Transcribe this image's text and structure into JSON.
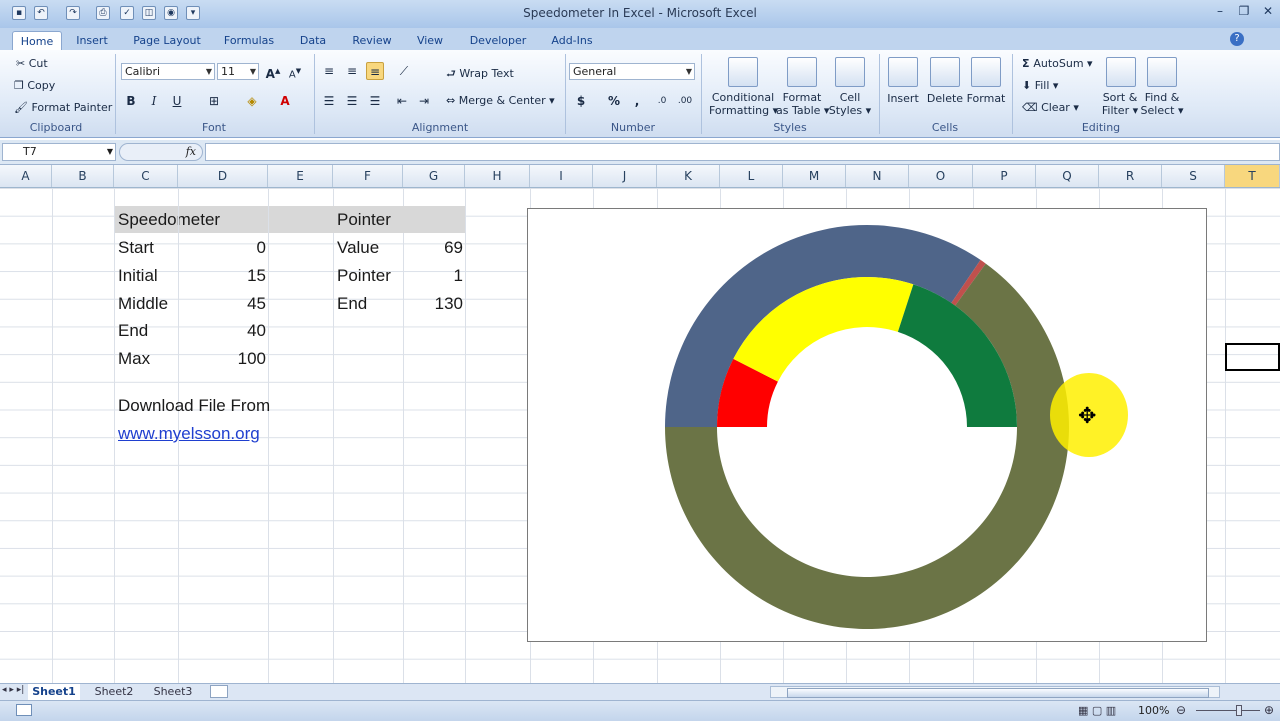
{
  "window": {
    "title": "Speedometer In Excel - Microsoft Excel"
  },
  "tabs": [
    "Home",
    "Insert",
    "Page Layout",
    "Formulas",
    "Data",
    "Review",
    "View",
    "Developer",
    "Add-Ins"
  ],
  "clipboard": {
    "cut": "Cut",
    "copy": "Copy",
    "format_painter": "Format Painter",
    "label": "Clipboard"
  },
  "font": {
    "name": "Calibri",
    "size": "11",
    "label": "Font"
  },
  "alignment": {
    "wrap": "Wrap Text",
    "merge": "Merge & Center",
    "label": "Alignment"
  },
  "number": {
    "format": "General",
    "label": "Number"
  },
  "styles": {
    "conditional": "Conditional",
    "formatting": "Formatting",
    "format_as": "Format",
    "as_table": "as Table",
    "cell": "Cell",
    "cell_styles": "Styles",
    "label": "Styles"
  },
  "cells": {
    "insert": "Insert",
    "delete": "Delete",
    "format": "Format",
    "label": "Cells"
  },
  "editing": {
    "autosum": "AutoSum",
    "fill": "Fill",
    "clear": "Clear",
    "sort": "Sort &",
    "filter": "Filter",
    "find": "Find &",
    "select": "Select",
    "label": "Editing"
  },
  "namebox": "T7",
  "columns": [
    "A",
    "B",
    "C",
    "D",
    "E",
    "F",
    "G",
    "H",
    "I",
    "J",
    "K",
    "L",
    "M",
    "N",
    "O",
    "P",
    "Q",
    "R",
    "S",
    "T"
  ],
  "table1": {
    "header": "Speedometer",
    "rows": [
      {
        "label": "Start",
        "value": "0"
      },
      {
        "label": "Initial",
        "value": "15"
      },
      {
        "label": "Middle",
        "value": "45"
      },
      {
        "label": "End",
        "value": "40"
      },
      {
        "label": "Max",
        "value": "100"
      }
    ]
  },
  "table2": {
    "header": "Pointer",
    "rows": [
      {
        "label": "Value",
        "value": "69"
      },
      {
        "label": "Pointer",
        "value": "1"
      },
      {
        "label": "End",
        "value": "130"
      }
    ]
  },
  "download": {
    "text": "Download File From",
    "link": "www.myelsson.org"
  },
  "chart_data": {
    "type": "pie",
    "series": [
      {
        "values": [
          69,
          1,
          130
        ]
      },
      {
        "values": [
          0,
          15,
          45,
          40,
          100
        ]
      }
    ],
    "colors": {
      "pointer_start": "#4f6589",
      "pointer": "#c0504d",
      "pointer_end": "#6b7446",
      "initial": "#ff0000",
      "middle": "#ffff00",
      "end": "#0f7b3e"
    }
  },
  "sheets": [
    "Sheet1",
    "Sheet2",
    "Sheet3"
  ],
  "status": {
    "zoom": "100%"
  }
}
